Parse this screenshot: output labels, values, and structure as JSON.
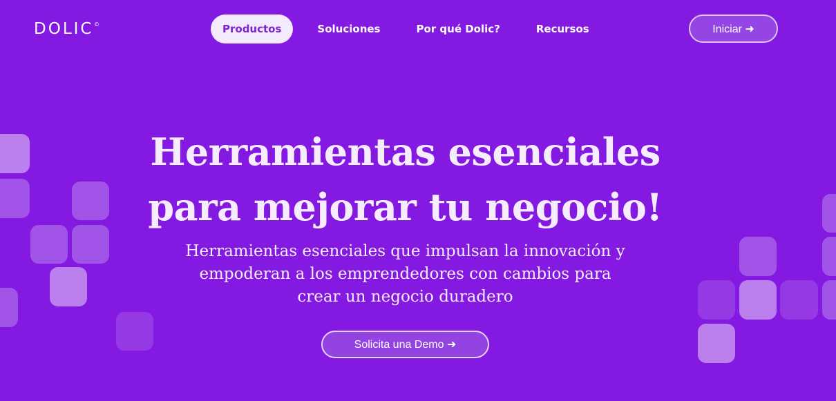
{
  "brand": {
    "logo": "DOLIC",
    "logo_mark": "©"
  },
  "nav": {
    "items": [
      {
        "label": "Productos",
        "active": true
      },
      {
        "label": "Soluciones",
        "active": false
      },
      {
        "label": "Por qué Dolic?",
        "active": false
      },
      {
        "label": "Recursos",
        "active": false
      }
    ],
    "cta_label": "Iniciar ➜"
  },
  "hero": {
    "title_line1": "Herramientas esenciales",
    "title_line2": "para mejorar tu negocio!",
    "subtitle_line1": "Herramientas esenciales que impulsan la innovación y",
    "subtitle_line2": "empoderan a los emprendedores con cambios para",
    "subtitle_line3": "crear un negocio duradero",
    "demo_label": "Solicita una Demo ➜"
  },
  "colors": {
    "background": "#8419e1",
    "active_pill_bg": "#f4eafd",
    "active_pill_text": "#7d24cf",
    "text_light": "#f6ecff"
  }
}
